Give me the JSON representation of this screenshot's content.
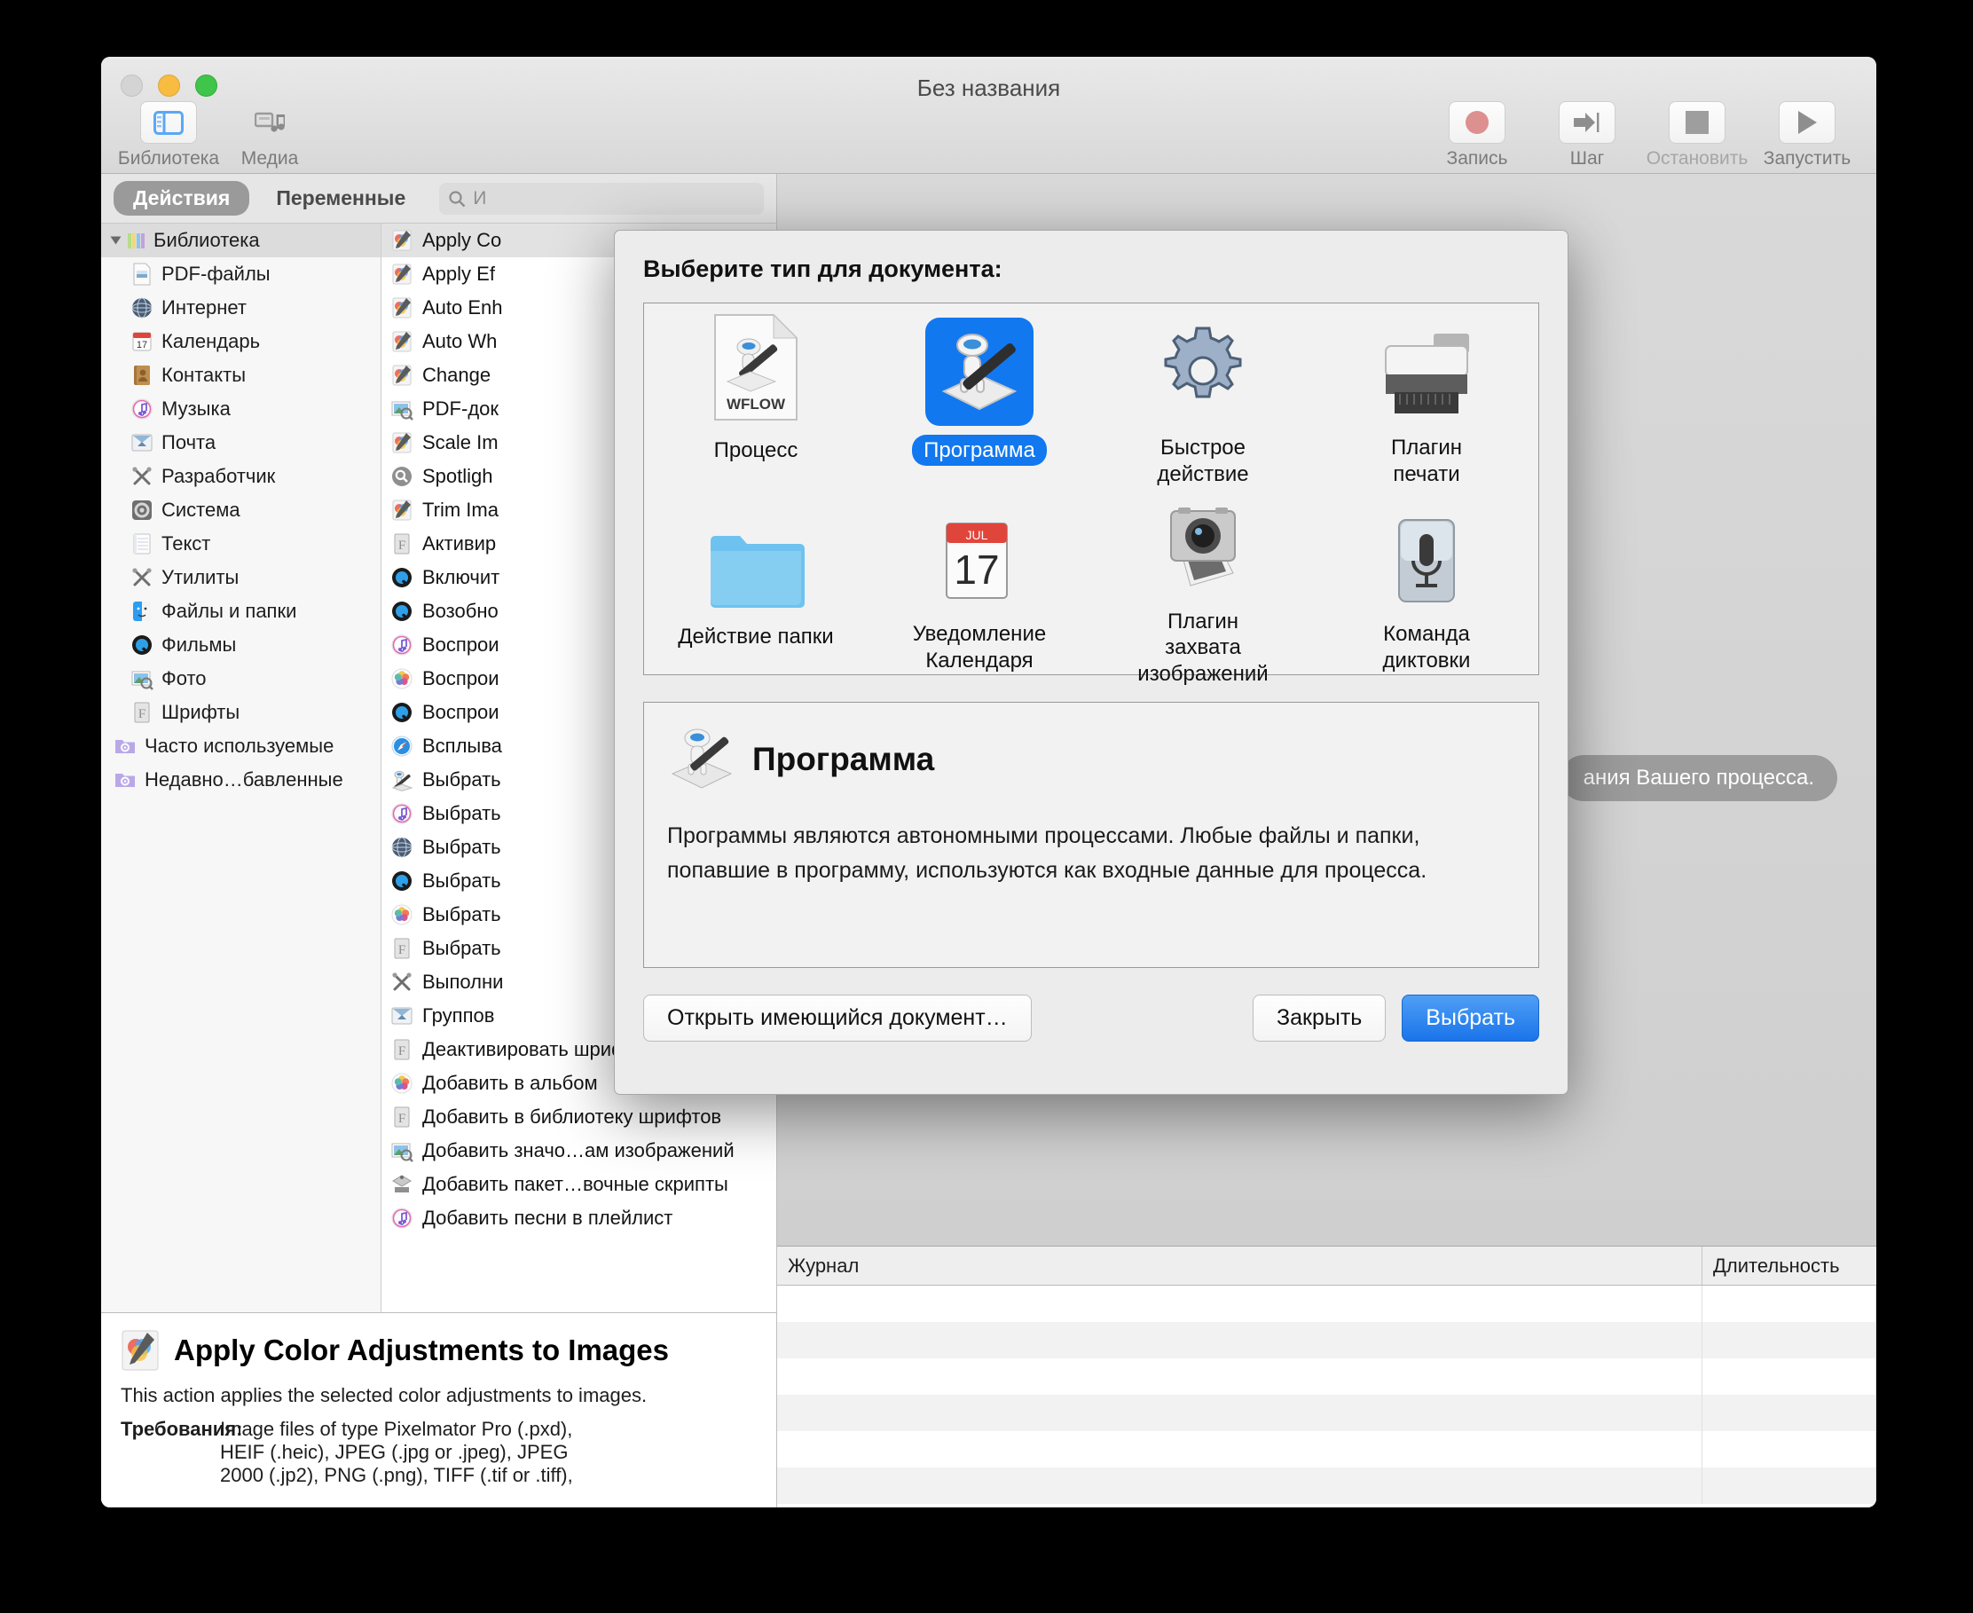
{
  "window": {
    "title": "Без названия"
  },
  "toolbar": {
    "left": [
      {
        "label": "Библиотека",
        "icon": "library-panel-icon",
        "active": true
      },
      {
        "label": "Медиа",
        "icon": "media-icon",
        "active": false
      }
    ],
    "right": [
      {
        "label": "Запись",
        "icon": "record-icon",
        "enabled": true
      },
      {
        "label": "Шаг",
        "icon": "step-icon",
        "enabled": true
      },
      {
        "label": "Остановить",
        "icon": "stop-icon",
        "enabled": false
      },
      {
        "label": "Запустить",
        "icon": "run-icon",
        "enabled": true
      }
    ]
  },
  "tabs": [
    {
      "label": "Действия",
      "active": true
    },
    {
      "label": "Переменные",
      "active": false
    }
  ],
  "search": {
    "placeholder": "И",
    "value": "",
    "icon": "search-icon"
  },
  "library": {
    "root": {
      "label": "Библиотека",
      "icon": "library-books-icon"
    },
    "items": [
      {
        "label": "PDF-файлы",
        "icon": "pdf-file-icon"
      },
      {
        "label": "Интернет",
        "icon": "globe-icon"
      },
      {
        "label": "Календарь",
        "icon": "calendar-icon"
      },
      {
        "label": "Контакты",
        "icon": "contacts-icon"
      },
      {
        "label": "Музыка",
        "icon": "music-icon"
      },
      {
        "label": "Почта",
        "icon": "mail-icon"
      },
      {
        "label": "Разработчик",
        "icon": "developer-tools-icon"
      },
      {
        "label": "Система",
        "icon": "system-gear-icon"
      },
      {
        "label": "Текст",
        "icon": "text-notes-icon"
      },
      {
        "label": "Утилиты",
        "icon": "utilities-icon"
      },
      {
        "label": "Файлы и папки",
        "icon": "finder-icon"
      },
      {
        "label": "Фильмы",
        "icon": "quicktime-icon"
      },
      {
        "label": "Фото",
        "icon": "photos-preview-icon"
      },
      {
        "label": "Шрифты",
        "icon": "fontbook-icon"
      }
    ],
    "smart_folders": [
      {
        "label": "Часто используемые",
        "icon": "smart-folder-icon"
      },
      {
        "label": "Недавно…бавленные",
        "icon": "smart-folder-icon"
      }
    ]
  },
  "actions": [
    {
      "label": "Apply Co",
      "icon": "pixelmator-icon",
      "selected": true
    },
    {
      "label": "Apply Ef",
      "icon": "pixelmator-icon"
    },
    {
      "label": "Auto Enh",
      "icon": "pixelmator-icon"
    },
    {
      "label": "Auto Wh",
      "icon": "pixelmator-icon"
    },
    {
      "label": "Change ",
      "icon": "pixelmator-icon"
    },
    {
      "label": "PDF-док",
      "icon": "photos-preview-icon"
    },
    {
      "label": "Scale Im",
      "icon": "pixelmator-icon"
    },
    {
      "label": "Spotligh",
      "icon": "spotlight-icon"
    },
    {
      "label": "Trim Ima",
      "icon": "pixelmator-icon"
    },
    {
      "label": "Активир",
      "icon": "fontbook-icon"
    },
    {
      "label": "Включит",
      "icon": "quicktime-icon"
    },
    {
      "label": "Возобно",
      "icon": "quicktime-icon"
    },
    {
      "label": "Воспрои",
      "icon": "music-icon"
    },
    {
      "label": "Воспрои",
      "icon": "photos-icon"
    },
    {
      "label": "Воспрои",
      "icon": "quicktime-icon"
    },
    {
      "label": "Всплыва",
      "icon": "safari-icon"
    },
    {
      "label": "Выбрать",
      "icon": "automator-icon"
    },
    {
      "label": "Выбрать",
      "icon": "music-icon"
    },
    {
      "label": "Выбрать",
      "icon": "globe-icon"
    },
    {
      "label": "Выбрать",
      "icon": "quicktime-icon"
    },
    {
      "label": "Выбрать",
      "icon": "photos-icon"
    },
    {
      "label": "Выбрать",
      "icon": "fontbook-icon"
    },
    {
      "label": "Выполни",
      "icon": "utilities-icon"
    },
    {
      "label": "Группов",
      "icon": "mail-icon"
    },
    {
      "label": "Деактивировать шрифты",
      "icon": "fontbook-icon"
    },
    {
      "label": "Добавить в альбом",
      "icon": "photos-icon"
    },
    {
      "label": "Добавить в библиотеку шрифтов",
      "icon": "fontbook-icon"
    },
    {
      "label": "Добавить значо…ам изображений",
      "icon": "photos-preview-icon"
    },
    {
      "label": "Добавить пакет…вочные скрипты",
      "icon": "folder-action-icon"
    },
    {
      "label": "Добавить песни в плейлист",
      "icon": "music-icon"
    }
  ],
  "action_info": {
    "title": "Apply Color Adjustments to Images",
    "icon": "pixelmator-icon",
    "description": "This action applies the selected color adjustments to images.",
    "requirements_label": "Требования:",
    "requirements_lines": [
      "Image files of type Pixelmator Pro (.pxd),",
      "HEIF (.heic), JPEG (.jpg or .jpeg), JPEG",
      "2000 (.jp2), PNG (.png), TIFF (.tif or .tiff),"
    ]
  },
  "canvas": {
    "hint": "ания Вашего процесса."
  },
  "log": {
    "columns": [
      "Журнал",
      "Длительность"
    ],
    "rows": [
      [
        "",
        ""
      ],
      [
        "",
        ""
      ],
      [
        "",
        ""
      ],
      [
        "",
        ""
      ],
      [
        "",
        ""
      ],
      [
        "",
        ""
      ]
    ]
  },
  "statusbar": {
    "gear": "gear-dropdown-button",
    "toggle": "disclosure-button",
    "view_list": "list-view-icon",
    "view_split": "split-view-icon"
  },
  "dialog": {
    "title": "Выберите тип для документа:",
    "types": [
      {
        "label": "Процесс",
        "icon": "workflow-file-icon",
        "selected": false
      },
      {
        "label": "Программа",
        "icon": "automator-app-icon",
        "selected": true
      },
      {
        "label": "Быстрое действие",
        "icon": "gear-icon",
        "selected": false
      },
      {
        "label": "Плагин печати",
        "icon": "printer-icon",
        "selected": false
      },
      {
        "label": "Действие папки",
        "icon": "blue-folder-icon",
        "selected": false
      },
      {
        "label": "Уведомление Календаря",
        "icon": "calendar-icon",
        "selected": false
      },
      {
        "label": "Плагин захвата изображений",
        "icon": "camera-icon",
        "selected": false
      },
      {
        "label": "Команда диктовки",
        "icon": "microphone-icon",
        "selected": false
      }
    ],
    "detail": {
      "title": "Программа",
      "icon": "automator-robot-icon",
      "text": "Программы являются автономными процессами. Любые файлы и папки, попавшие в программу, используются как входные данные для процесса."
    },
    "buttons": {
      "open_existing": "Открыть имеющийся документ…",
      "close": "Закрыть",
      "choose": "Выбрать"
    }
  },
  "colors": {
    "accent_blue": "#1278f0",
    "window_bg": "#ececec",
    "traffic_close": "#d4d4d4",
    "traffic_min": "#f7bc40",
    "traffic_max": "#3fc54a"
  }
}
